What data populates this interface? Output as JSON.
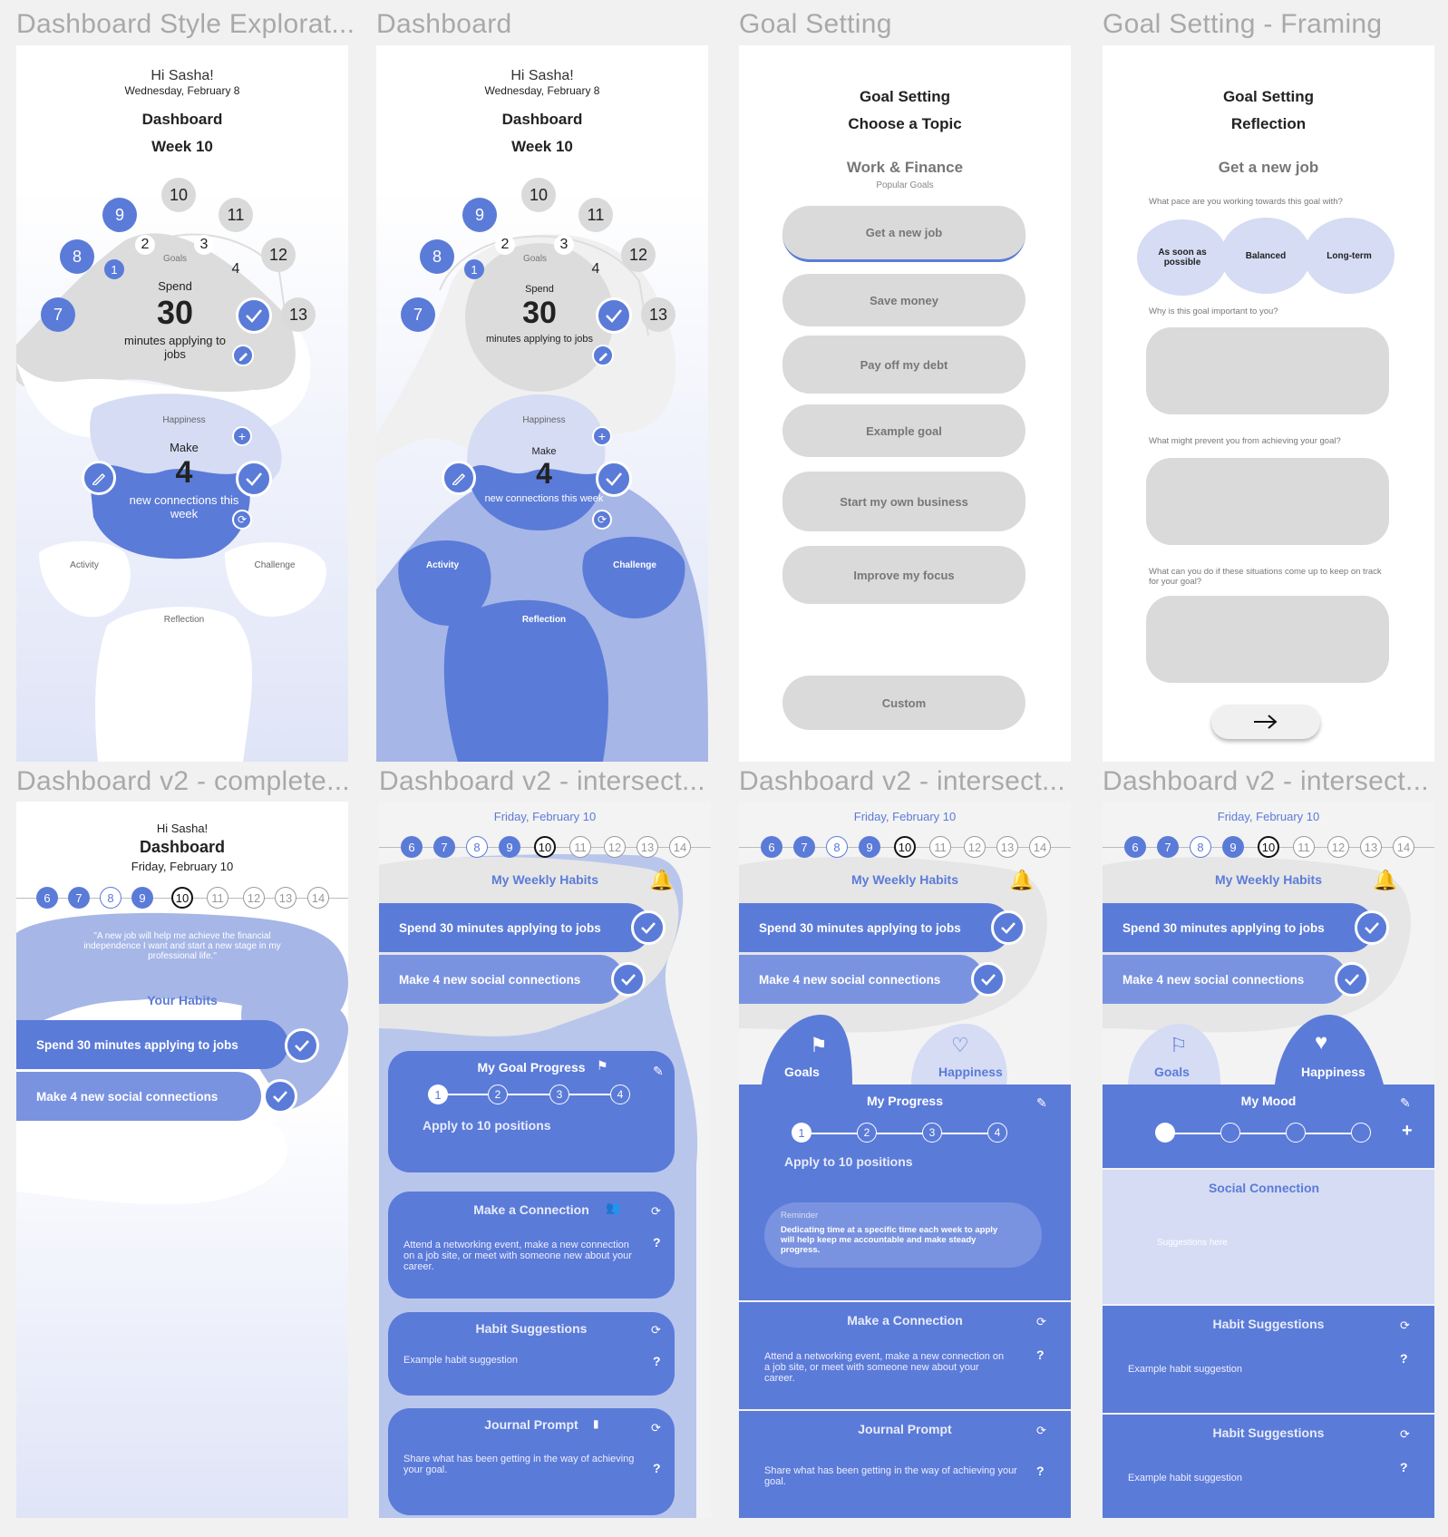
{
  "frames": {
    "f1": "Dashboard Style Explorat...",
    "f2": "Dashboard",
    "f3": "Goal Setting",
    "f4": "Goal Setting - Framing",
    "f5": "Dashboard v2 - complete...",
    "f6": "Dashboard v2 - intersect...",
    "f7": "Dashboard v2 - intersect...",
    "f8": "Dashboard v2 - intersect..."
  },
  "dash": {
    "greeting": "Hi Sasha!",
    "date": "Wednesday, February 8",
    "title": "Dashboard",
    "week": "Week 10",
    "weeks": [
      "7",
      "8",
      "9",
      "10",
      "11",
      "12",
      "13"
    ],
    "goals": [
      "1",
      "2",
      "3",
      "4"
    ],
    "goals_label": "Goals",
    "spend": "Spend",
    "spend_num": "30",
    "spend_desc": "minutes applying to jobs",
    "happiness": "Happiness",
    "make": "Make",
    "make_num": "4",
    "make_desc": "new connections this week",
    "activity": "Activity",
    "challenge": "Challenge",
    "reflection": "Reflection"
  },
  "goal": {
    "title": "Goal Setting",
    "subtitle": "Choose a Topic",
    "category": "Work & Finance",
    "popular": "Popular Goals",
    "options": [
      "Get a new job",
      "Save money",
      "Pay off my debt",
      "Example goal",
      "Start my own business",
      "Improve my focus"
    ],
    "custom": "Custom"
  },
  "frame": {
    "title": "Goal Setting",
    "subtitle": "Reflection",
    "goal": "Get a new job",
    "q_pace": "What pace are you working towards this goal with?",
    "paces": [
      "As soon as possible",
      "Balanced",
      "Long-term"
    ],
    "q_why": "Why is this goal important to you?",
    "q_prevent": "What might prevent you from achieving your goal?",
    "q_plan": "What can you do if these situations come up to keep on track for your goal?"
  },
  "v2": {
    "greeting": "Hi Sasha!",
    "title": "Dashboard",
    "date": "Friday, February 10",
    "days": [
      "6",
      "7",
      "8",
      "9",
      "10",
      "11",
      "12",
      "13",
      "14"
    ],
    "quote": "\"A new job will help me achieve the financial independence I want and start a new stage in my professional life.\"",
    "your_habits": "Your Habits",
    "my_weekly": "My Weekly Habits",
    "habit1": "Spend 30 minutes applying to jobs",
    "habit2": "Make 4 new social connections",
    "goal_progress": "My Goal Progress",
    "my_progress": "My Progress",
    "steps": [
      "1",
      "2",
      "3",
      "4"
    ],
    "apply": "Apply to 10 positions",
    "make_conn": "Make a Connection",
    "conn_desc": "Attend a networking event, make a new connection on a job site, or meet with someone new about your career.",
    "habit_sugg": "Habit Suggestions",
    "habit_ex": "Example habit suggestion",
    "journal": "Journal Prompt",
    "journal_desc": "Share what has been getting in the way of achieving your goal.",
    "goals_tab": "Goals",
    "happy_tab": "Happiness",
    "reminder": "Reminder",
    "reminder_desc": "Dedicating time at a specific time each week to apply will help keep me accountable and make steady progress.",
    "my_mood": "My Mood",
    "social": "Social Connection",
    "sugg_here": "Suggestions here",
    "q": "?"
  }
}
